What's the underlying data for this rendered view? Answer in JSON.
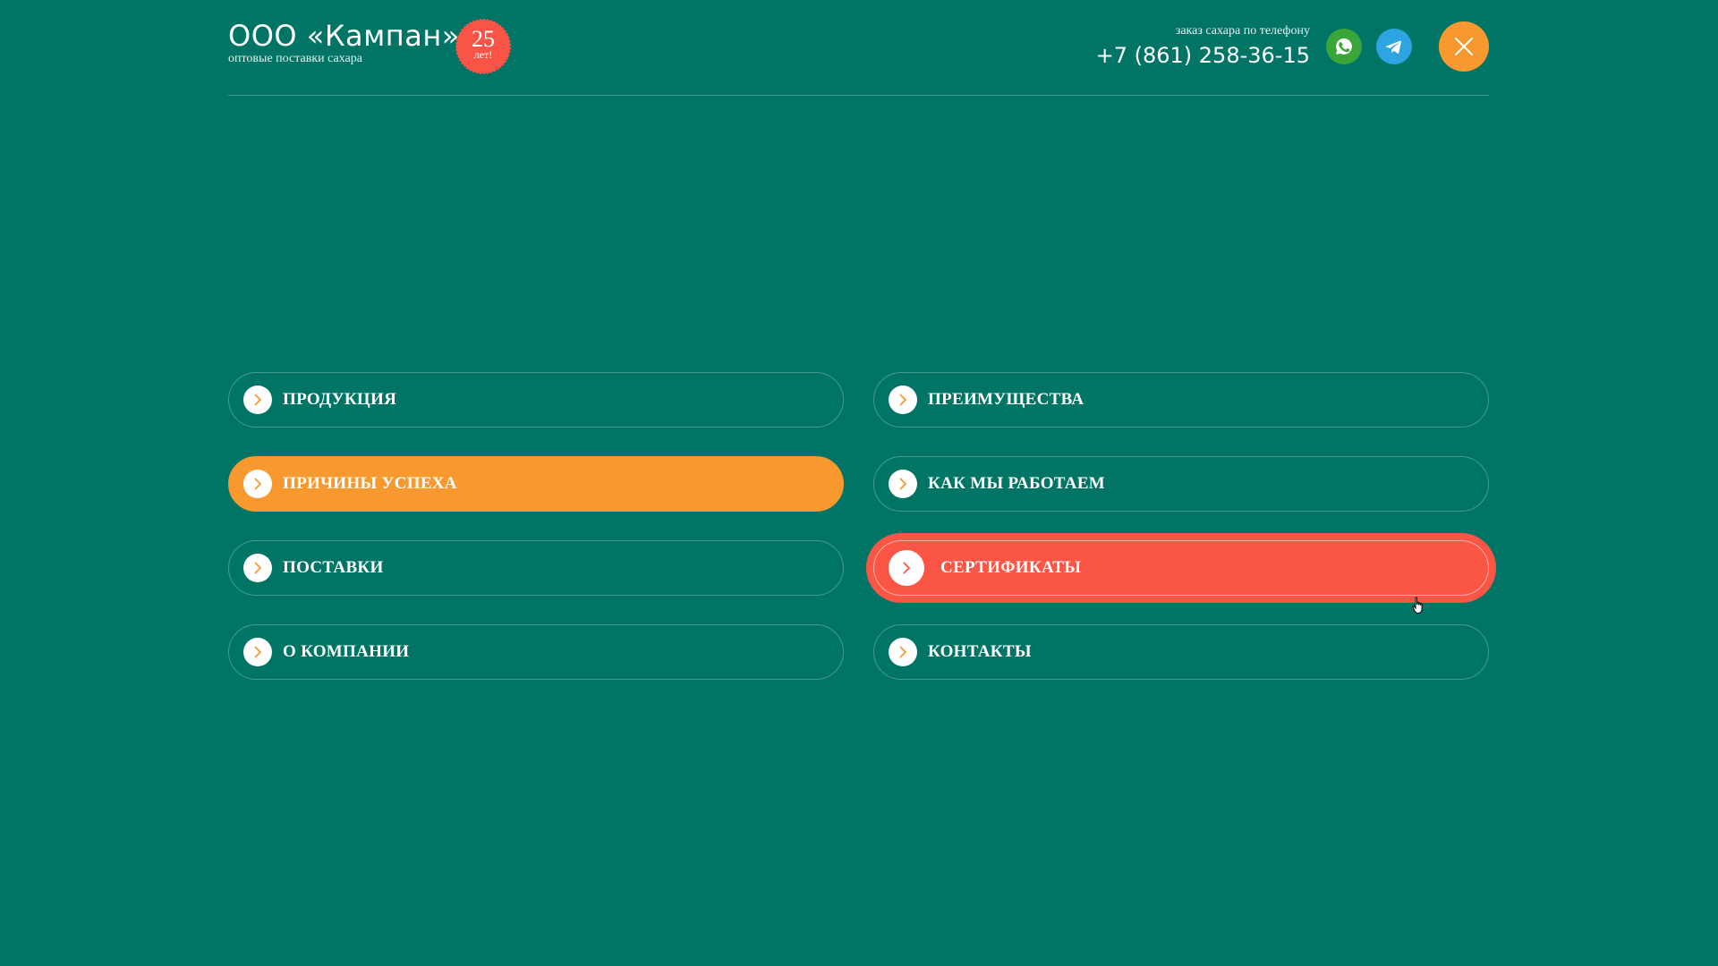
{
  "header": {
    "logo_title": "ООО «Кампан»",
    "logo_subtitle": "оптовые поставки сахара",
    "badge_number": "25",
    "badge_text": "лет!",
    "phone_caption": "заказ сахара по телефону",
    "phone_number": "+7 (861) 258-36-15",
    "icons": {
      "whatsapp": "whatsapp-icon",
      "telegram": "telegram-icon",
      "close": "close-icon"
    }
  },
  "menu": {
    "items": [
      {
        "label": "ПРОДУКЦИЯ"
      },
      {
        "label": "ПРЕИМУЩЕСТВА"
      },
      {
        "label": "ПРИЧИНЫ УСПЕХА"
      },
      {
        "label": "КАК МЫ РАБОТАЕМ"
      },
      {
        "label": "ПОСТАВКИ"
      },
      {
        "label": "СЕРТИФИКАТЫ"
      },
      {
        "label": "О КОМПАНИИ"
      },
      {
        "label": "КОНТАКТЫ"
      }
    ]
  },
  "colors": {
    "background": "#017565",
    "accent_orange": "#f7992e",
    "accent_red": "#fb5546",
    "whatsapp": "#3aa63a",
    "telegram": "#2ca5e0"
  }
}
